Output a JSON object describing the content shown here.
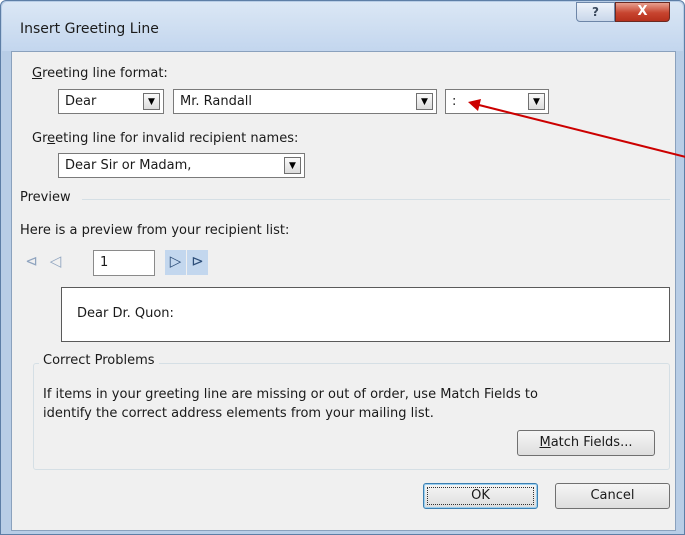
{
  "window": {
    "title": "Insert Greeting Line",
    "help_label": "?",
    "close_label": "X"
  },
  "greeting_format": {
    "label_access": "G",
    "label_rest": "reeting line format:",
    "salutation": {
      "value": "Dear"
    },
    "name_format": {
      "value": "Mr. Randall"
    },
    "punctuation": {
      "value": ":"
    }
  },
  "invalid_names": {
    "label_pre": "Gr",
    "label_access": "e",
    "label_post": "eting line for invalid recipient names:",
    "value": "Dear Sir or Madam,"
  },
  "preview": {
    "section_title": "Preview",
    "description": "Here is a preview from your recipient list:",
    "record_number": "1",
    "nav": {
      "first": "⊲",
      "prev": "◁",
      "next": "▷",
      "last": "⊳"
    },
    "text": "Dear Dr. Quon:"
  },
  "correct_problems": {
    "title": "Correct Problems",
    "body_line1": "If items in your greeting line are missing or out of order, use Match Fields to",
    "body_line2": "identify the correct address elements from your mailing list.",
    "match_access": "M",
    "match_rest": "atch Fields..."
  },
  "buttons": {
    "ok": "OK",
    "cancel": "Cancel"
  },
  "colors": {
    "annotation_arrow": "#cc0000",
    "title_bar": "#c3d6ee",
    "close_button": "#c7442f"
  }
}
